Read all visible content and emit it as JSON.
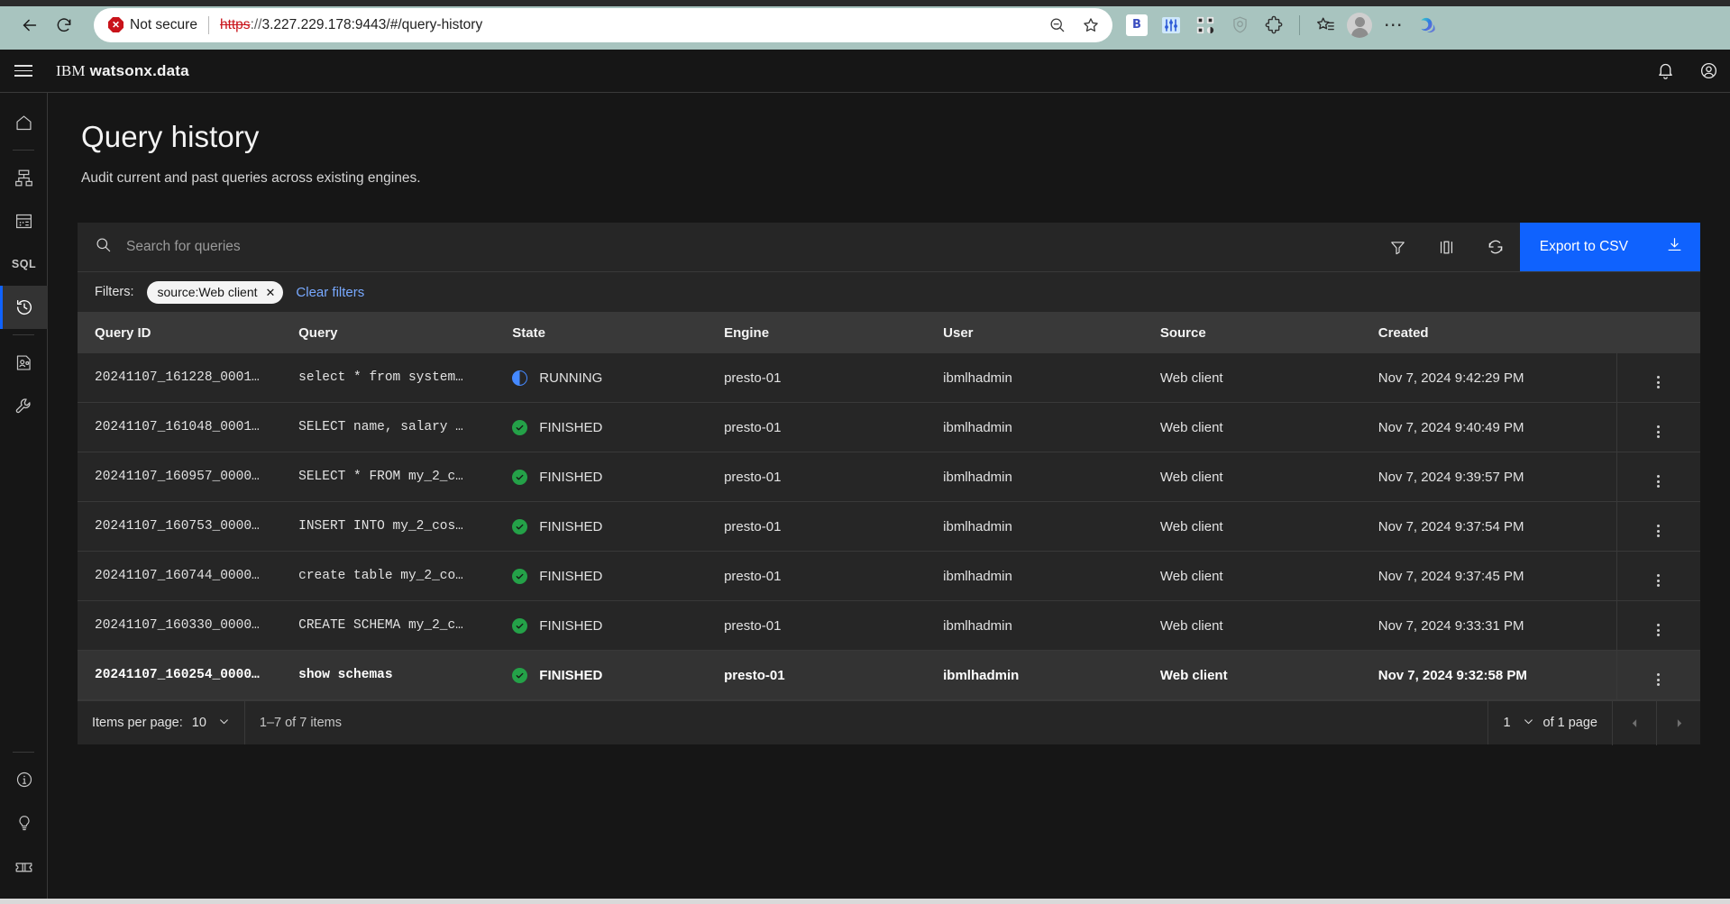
{
  "browser": {
    "back_icon": "back-arrow-icon",
    "reload_icon": "reload-icon",
    "security_label": "Not secure",
    "url_scheme": "https",
    "url_sep": "://",
    "url_rest": "3.227.229.178:9443/#/query-history",
    "zoom_out_icon": "zoom-out-icon",
    "favorite_icon": "star-icon",
    "extensions": [
      {
        "name": "bitwarden-extension",
        "label": "B"
      },
      {
        "name": "equalizer-extension",
        "label": ""
      },
      {
        "name": "qr-code-extension",
        "label": ""
      },
      {
        "name": "shield-extension",
        "label": ""
      },
      {
        "name": "puzzle-extensions",
        "label": ""
      }
    ],
    "collections_icon": "collections-icon",
    "profile_icon": "profile-avatar",
    "settings_icon": "more-options-icon",
    "copilot_icon": "copilot-icon"
  },
  "app_header": {
    "menu_icon": "hamburger-menu-icon",
    "brand_prefix": "IBM",
    "brand_name": "watsonx.data",
    "notifications_icon": "bell-icon",
    "account_icon": "user-avatar-icon"
  },
  "sidebar": {
    "items": [
      {
        "name": "sidebar-item-home",
        "icon": "home-icon",
        "active": false
      },
      {
        "name": "sidebar-item-infrastructure",
        "icon": "infrastructure-icon",
        "active": false
      },
      {
        "name": "sidebar-item-data-manager",
        "icon": "data-table-icon",
        "active": false
      },
      {
        "name": "sidebar-item-sql",
        "icon": "sql-icon",
        "label": "SQL",
        "active": false
      },
      {
        "name": "sidebar-item-query-history",
        "icon": "history-clock-icon",
        "active": true
      },
      {
        "name": "sidebar-item-access-control",
        "icon": "user-access-icon",
        "active": false
      },
      {
        "name": "sidebar-item-configurations",
        "icon": "wrench-icon",
        "active": false
      }
    ],
    "bottom_items": [
      {
        "name": "sidebar-item-about",
        "icon": "info-icon"
      },
      {
        "name": "sidebar-item-whats-new",
        "icon": "lightbulb-icon"
      },
      {
        "name": "sidebar-item-support",
        "icon": "ticket-icon"
      }
    ]
  },
  "page": {
    "title": "Query history",
    "subtitle": "Audit current and past queries across existing engines."
  },
  "toolbar": {
    "search_placeholder": "Search for queries",
    "search_value": "",
    "search_icon": "search-icon",
    "filter_icon": "filter-icon",
    "columns_icon": "column-settings-icon",
    "refresh_icon": "refresh-icon",
    "export_label": "Export to CSV",
    "export_icon": "download-icon",
    "export_color": "#0f62fe"
  },
  "filters": {
    "label": "Filters:",
    "chips": [
      {
        "text": "source:Web client",
        "close_icon": "close-icon"
      }
    ],
    "clear_label": "Clear filters",
    "clear_color": "#78a9ff"
  },
  "table": {
    "columns": [
      "Query ID",
      "Query",
      "State",
      "Engine",
      "User",
      "Source",
      "Created"
    ],
    "rows": [
      {
        "query_id": "20241107_161228_0001…",
        "query": "select * from system…",
        "state": "RUNNING",
        "state_kind": "running",
        "engine": "presto-01",
        "user": "ibmlhadmin",
        "source": "Web client",
        "created": "Nov 7, 2024 9:42:29 PM",
        "selected": false,
        "query_is_link": false
      },
      {
        "query_id": "20241107_161048_0001…",
        "query": "SELECT name, salary …",
        "state": "FINISHED",
        "state_kind": "finished",
        "engine": "presto-01",
        "user": "ibmlhadmin",
        "source": "Web client",
        "created": "Nov 7, 2024 9:40:49 PM",
        "selected": false,
        "query_is_link": false
      },
      {
        "query_id": "20241107_160957_0000…",
        "query": "SELECT * FROM my_2_c…",
        "state": "FINISHED",
        "state_kind": "finished",
        "engine": "presto-01",
        "user": "ibmlhadmin",
        "source": "Web client",
        "created": "Nov 7, 2024 9:39:57 PM",
        "selected": false,
        "query_is_link": false
      },
      {
        "query_id": "20241107_160753_0000…",
        "query": "INSERT INTO my_2_cos…",
        "state": "FINISHED",
        "state_kind": "finished",
        "engine": "presto-01",
        "user": "ibmlhadmin",
        "source": "Web client",
        "created": "Nov 7, 2024 9:37:54 PM",
        "selected": false,
        "query_is_link": false
      },
      {
        "query_id": "20241107_160744_0000…",
        "query": "create table my_2_co…",
        "state": "FINISHED",
        "state_kind": "finished",
        "engine": "presto-01",
        "user": "ibmlhadmin",
        "source": "Web client",
        "created": "Nov 7, 2024 9:37:45 PM",
        "selected": false,
        "query_is_link": false
      },
      {
        "query_id": "20241107_160330_0000…",
        "query": "CREATE SCHEMA my_2_c…",
        "state": "FINISHED",
        "state_kind": "finished",
        "engine": "presto-01",
        "user": "ibmlhadmin",
        "source": "Web client",
        "created": "Nov 7, 2024 9:33:31 PM",
        "selected": false,
        "query_is_link": false
      },
      {
        "query_id": "20241107_160254_0000…",
        "query": "show schemas",
        "state": "FINISHED",
        "state_kind": "finished",
        "engine": "presto-01",
        "user": "ibmlhadmin",
        "source": "Web client",
        "created": "Nov 7, 2024 9:32:58 PM",
        "selected": true,
        "query_is_link": true
      }
    ],
    "overflow_icon": "overflow-menu-icon",
    "status_colors": {
      "finished": "#24a148",
      "running": "#4589ff"
    }
  },
  "pagination": {
    "items_per_page_label": "Items per page:",
    "items_per_page_value": "10",
    "range_text": "1–7 of 7 items",
    "page_value": "1",
    "of_pages_text": "of 1 page",
    "prev_icon": "caret-left-icon",
    "next_icon": "caret-right-icon"
  }
}
